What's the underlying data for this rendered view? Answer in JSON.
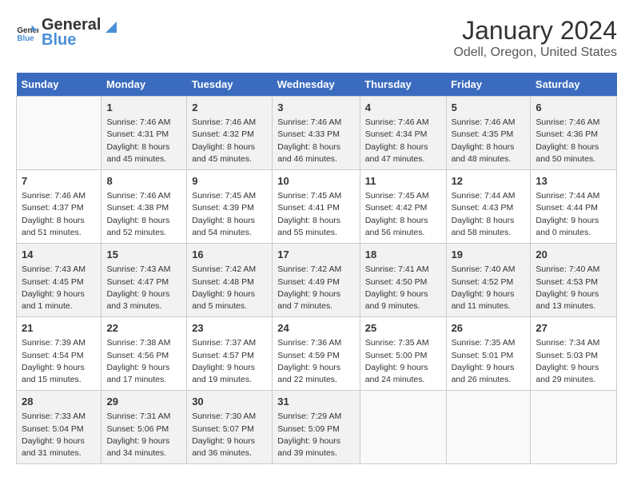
{
  "header": {
    "logo_general": "General",
    "logo_blue": "Blue",
    "title": "January 2024",
    "subtitle": "Odell, Oregon, United States"
  },
  "days_of_week": [
    "Sunday",
    "Monday",
    "Tuesday",
    "Wednesday",
    "Thursday",
    "Friday",
    "Saturday"
  ],
  "weeks": [
    [
      {
        "day": "",
        "info": ""
      },
      {
        "day": "1",
        "info": "Sunrise: 7:46 AM\nSunset: 4:31 PM\nDaylight: 8 hours and 45 minutes."
      },
      {
        "day": "2",
        "info": "Sunrise: 7:46 AM\nSunset: 4:32 PM\nDaylight: 8 hours and 45 minutes."
      },
      {
        "day": "3",
        "info": "Sunrise: 7:46 AM\nSunset: 4:33 PM\nDaylight: 8 hours and 46 minutes."
      },
      {
        "day": "4",
        "info": "Sunrise: 7:46 AM\nSunset: 4:34 PM\nDaylight: 8 hours and 47 minutes."
      },
      {
        "day": "5",
        "info": "Sunrise: 7:46 AM\nSunset: 4:35 PM\nDaylight: 8 hours and 48 minutes."
      },
      {
        "day": "6",
        "info": "Sunrise: 7:46 AM\nSunset: 4:36 PM\nDaylight: 8 hours and 50 minutes."
      }
    ],
    [
      {
        "day": "7",
        "info": "Sunrise: 7:46 AM\nSunset: 4:37 PM\nDaylight: 8 hours and 51 minutes."
      },
      {
        "day": "8",
        "info": "Sunrise: 7:46 AM\nSunset: 4:38 PM\nDaylight: 8 hours and 52 minutes."
      },
      {
        "day": "9",
        "info": "Sunrise: 7:45 AM\nSunset: 4:39 PM\nDaylight: 8 hours and 54 minutes."
      },
      {
        "day": "10",
        "info": "Sunrise: 7:45 AM\nSunset: 4:41 PM\nDaylight: 8 hours and 55 minutes."
      },
      {
        "day": "11",
        "info": "Sunrise: 7:45 AM\nSunset: 4:42 PM\nDaylight: 8 hours and 56 minutes."
      },
      {
        "day": "12",
        "info": "Sunrise: 7:44 AM\nSunset: 4:43 PM\nDaylight: 8 hours and 58 minutes."
      },
      {
        "day": "13",
        "info": "Sunrise: 7:44 AM\nSunset: 4:44 PM\nDaylight: 9 hours and 0 minutes."
      }
    ],
    [
      {
        "day": "14",
        "info": "Sunrise: 7:43 AM\nSunset: 4:45 PM\nDaylight: 9 hours and 1 minute."
      },
      {
        "day": "15",
        "info": "Sunrise: 7:43 AM\nSunset: 4:47 PM\nDaylight: 9 hours and 3 minutes."
      },
      {
        "day": "16",
        "info": "Sunrise: 7:42 AM\nSunset: 4:48 PM\nDaylight: 9 hours and 5 minutes."
      },
      {
        "day": "17",
        "info": "Sunrise: 7:42 AM\nSunset: 4:49 PM\nDaylight: 9 hours and 7 minutes."
      },
      {
        "day": "18",
        "info": "Sunrise: 7:41 AM\nSunset: 4:50 PM\nDaylight: 9 hours and 9 minutes."
      },
      {
        "day": "19",
        "info": "Sunrise: 7:40 AM\nSunset: 4:52 PM\nDaylight: 9 hours and 11 minutes."
      },
      {
        "day": "20",
        "info": "Sunrise: 7:40 AM\nSunset: 4:53 PM\nDaylight: 9 hours and 13 minutes."
      }
    ],
    [
      {
        "day": "21",
        "info": "Sunrise: 7:39 AM\nSunset: 4:54 PM\nDaylight: 9 hours and 15 minutes."
      },
      {
        "day": "22",
        "info": "Sunrise: 7:38 AM\nSunset: 4:56 PM\nDaylight: 9 hours and 17 minutes."
      },
      {
        "day": "23",
        "info": "Sunrise: 7:37 AM\nSunset: 4:57 PM\nDaylight: 9 hours and 19 minutes."
      },
      {
        "day": "24",
        "info": "Sunrise: 7:36 AM\nSunset: 4:59 PM\nDaylight: 9 hours and 22 minutes."
      },
      {
        "day": "25",
        "info": "Sunrise: 7:35 AM\nSunset: 5:00 PM\nDaylight: 9 hours and 24 minutes."
      },
      {
        "day": "26",
        "info": "Sunrise: 7:35 AM\nSunset: 5:01 PM\nDaylight: 9 hours and 26 minutes."
      },
      {
        "day": "27",
        "info": "Sunrise: 7:34 AM\nSunset: 5:03 PM\nDaylight: 9 hours and 29 minutes."
      }
    ],
    [
      {
        "day": "28",
        "info": "Sunrise: 7:33 AM\nSunset: 5:04 PM\nDaylight: 9 hours and 31 minutes."
      },
      {
        "day": "29",
        "info": "Sunrise: 7:31 AM\nSunset: 5:06 PM\nDaylight: 9 hours and 34 minutes."
      },
      {
        "day": "30",
        "info": "Sunrise: 7:30 AM\nSunset: 5:07 PM\nDaylight: 9 hours and 36 minutes."
      },
      {
        "day": "31",
        "info": "Sunrise: 7:29 AM\nSunset: 5:09 PM\nDaylight: 9 hours and 39 minutes."
      },
      {
        "day": "",
        "info": ""
      },
      {
        "day": "",
        "info": ""
      },
      {
        "day": "",
        "info": ""
      }
    ]
  ]
}
